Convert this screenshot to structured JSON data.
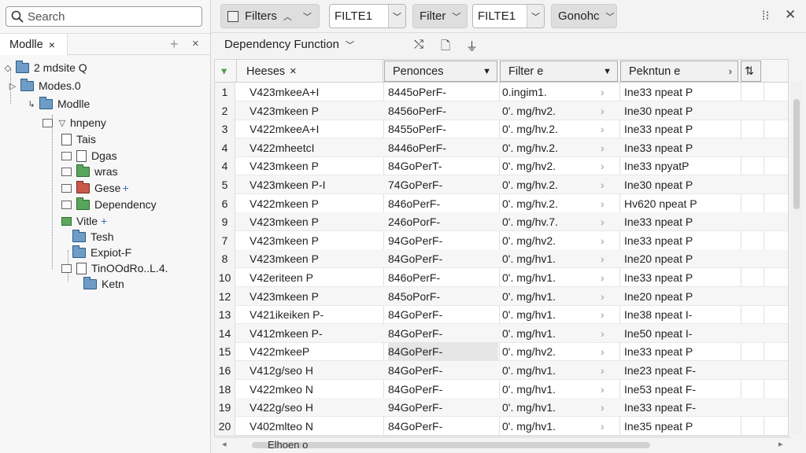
{
  "search": {
    "placeholder": "Search"
  },
  "left_panel": {
    "tab_label": "Modlle",
    "tab_close": "×",
    "add": "+",
    "close": "×"
  },
  "tree": [
    {
      "label": "2 mdsite Q"
    },
    {
      "label": "Modes.0"
    },
    {
      "label": "Modlle"
    },
    {
      "label": "hnpeny"
    },
    {
      "label": "Tais"
    },
    {
      "label": "Dgas"
    },
    {
      "label": "wras"
    },
    {
      "label": "Gese"
    },
    {
      "label": "Dependency"
    },
    {
      "label": "Vitle"
    },
    {
      "label": "Tesh"
    },
    {
      "label": "Expiot-F"
    },
    {
      "label": "TinOOdRo..L.4."
    },
    {
      "label": "Ketn"
    }
  ],
  "toolbar": {
    "filters_label": "Filters",
    "filter1_value": "FILTE1",
    "filter_label": "Filter",
    "filter2_value": "FILTE1",
    "gonohc_label": "Gonohc"
  },
  "subbar": {
    "dependency_label": "Dependency Function"
  },
  "grid": {
    "headers": [
      "Heeses",
      "Penonces",
      "Filter e",
      "Pekntun e"
    ],
    "rows": [
      {
        "n": "1",
        "a": "V423mkeeA+I",
        "b": "8445oPerF-",
        "c": "0.ingim1.",
        "d": "Ine33 npeat P"
      },
      {
        "n": "2",
        "a": "V423mkeen P",
        "b": "8456oPerF-",
        "c": "0'. mg/hv2.",
        "d": "Ine30 npeat P"
      },
      {
        "n": "3",
        "a": "V422mkeeA+I",
        "b": "8455oPerF-",
        "c": "0'. mg/hv.2.",
        "d": "Ine33 npeat P"
      },
      {
        "n": "4",
        "a": "V422mheetcI",
        "b": "8446oPerF-",
        "c": "0'. mg/hv.2.",
        "d": "Ine33 npeat P"
      },
      {
        "n": "4",
        "a": "V423mkeen P",
        "b": "84GoPerT-",
        "c": "0'. mg/hv2.",
        "d": "Ine33 npyatP"
      },
      {
        "n": "5",
        "a": "V423mkeen P-I",
        "b": "74GoPerF-",
        "c": "0'. mg/hv.2.",
        "d": "Ine30 npeat P"
      },
      {
        "n": "6",
        "a": "V422mkeen P",
        "b": "846oPerF-",
        "c": "0'. mg/hv.2.",
        "d": "Hv620 npeat P"
      },
      {
        "n": "9",
        "a": "V423mkeen P",
        "b": "246oPorF-",
        "c": "0'. mg/hv.7.",
        "d": "Ine33 npeat P"
      },
      {
        "n": "7",
        "a": "V423mkeen P",
        "b": "94GoPerF-",
        "c": "0'. mg/hv2.",
        "d": "Ine33 npeat P"
      },
      {
        "n": "8",
        "a": "V423mkeen P",
        "b": "84GoPerF-",
        "c": "0'. mg/hv1.",
        "d": "Ine20 npeat P"
      },
      {
        "n": "10",
        "a": "V42eriteen P",
        "b": "846oPerF-",
        "c": "0'. mg/hv1.",
        "d": "Ine33 npeat P"
      },
      {
        "n": "12",
        "a": "V423mkeen P",
        "b": "845oPorF-",
        "c": "0'. mg/hv1.",
        "d": "Ine20 npeat P"
      },
      {
        "n": "13",
        "a": "V421ikeiken P-",
        "b": "84GoPerF-",
        "c": "0'. mg/hv1.",
        "d": "Ine38 npeat I-"
      },
      {
        "n": "14",
        "a": "V412mkeen P-",
        "b": "84GoPerF-",
        "c": "0'. mg/hv1.",
        "d": "Ine50 npeat I-"
      },
      {
        "n": "15",
        "a": "V422mkeeP",
        "b": "84GoPerF-",
        "c": "0'. mg/hv2.",
        "d": "Ine33 npeat P"
      },
      {
        "n": "16",
        "a": "V412g/seo H",
        "b": "84GoPerF-",
        "c": "0'. mg/hv1.",
        "d": "Ine23 npeat F-"
      },
      {
        "n": "18",
        "a": "V422mkeo N",
        "b": "84GoPerF-",
        "c": "0'. mg/hv1.",
        "d": "Ine53 npeat F-"
      },
      {
        "n": "19",
        "a": "V422g/seo H",
        "b": "94GoPerF-",
        "c": "0'. mg/hv1.",
        "d": "Ine33 npeat F-"
      },
      {
        "n": "20",
        "a": "V402mlteo N",
        "b": "84GoPerF-",
        "c": "0'. mg/hv1.",
        "d": "Ine35 npeat P"
      }
    ]
  },
  "hscroll_label": "Elhoen o"
}
